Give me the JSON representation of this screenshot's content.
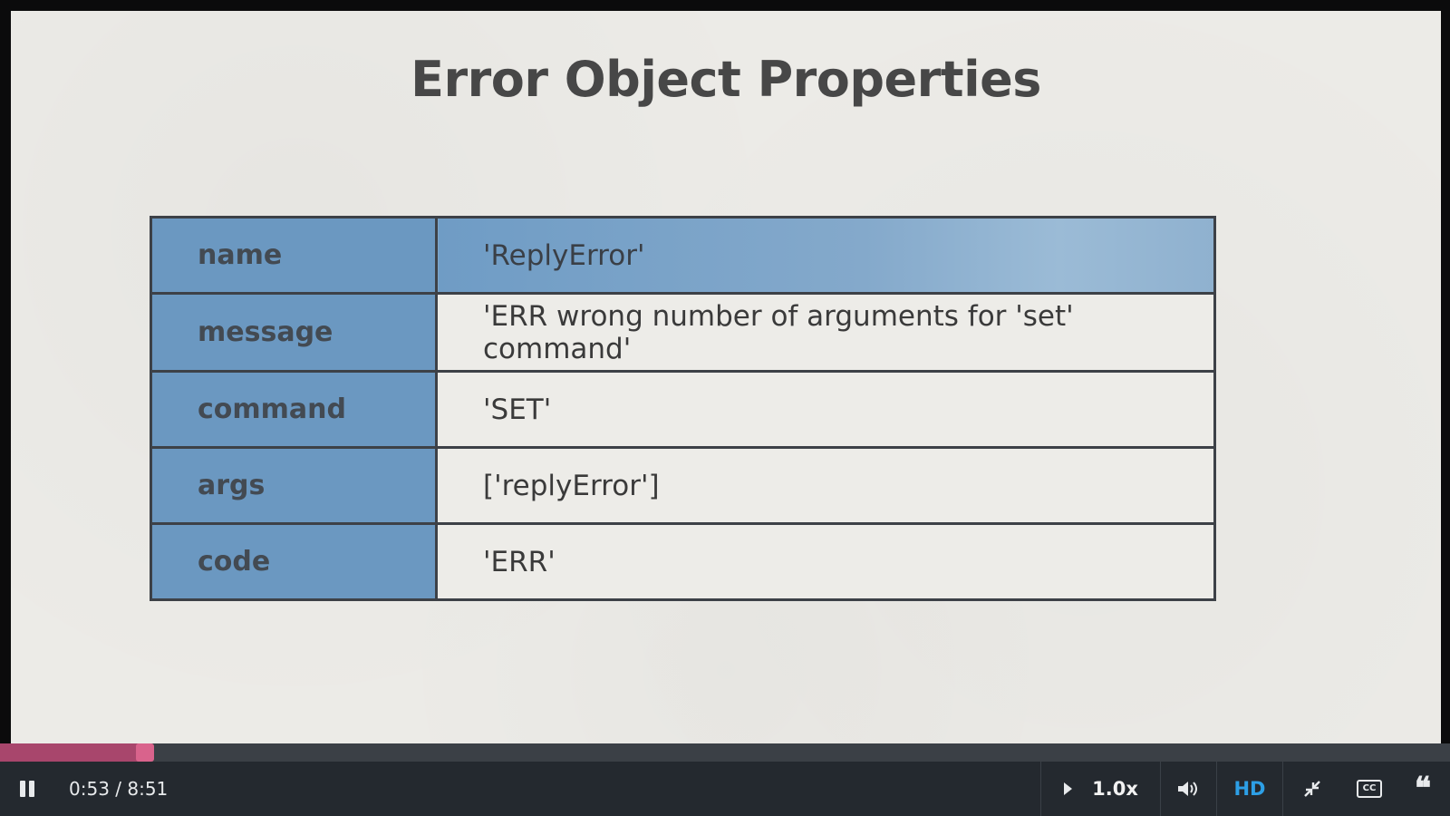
{
  "slide": {
    "title": "Error Object Properties",
    "table": [
      {
        "key": "name",
        "value": "'ReplyError'"
      },
      {
        "key": "message",
        "value": "'ERR wrong number of arguments for 'set' command'"
      },
      {
        "key": "command",
        "value": "'SET'"
      },
      {
        "key": "args",
        "value": "['replyError']"
      },
      {
        "key": "code",
        "value": "'ERR'"
      }
    ]
  },
  "player": {
    "progress_fraction": 0.1,
    "time_display": "0:53 / 8:51",
    "speed_label": "1.0x",
    "hd_label": "HD",
    "cc_label": "CC",
    "icons": [
      "pause-icon",
      "play-icon",
      "volume-icon",
      "exit-fullscreen-icon",
      "closed-captions-icon",
      "quote-icon"
    ],
    "colors": {
      "progress_fill": "#a8466c",
      "progress_handle": "#d9638c",
      "hd_accent": "#2d9fe6",
      "key_cell": "#6b98c1"
    }
  }
}
